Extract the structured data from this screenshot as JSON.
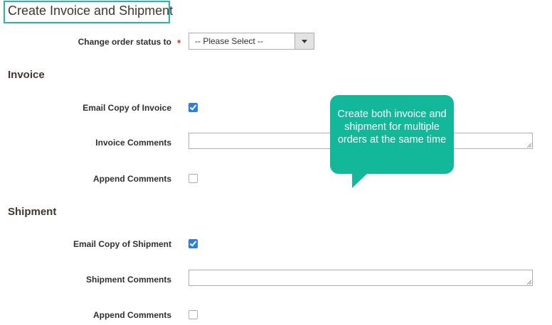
{
  "page": {
    "title": "Create Invoice and Shipment"
  },
  "order_status": {
    "label": "Change order status to",
    "required_mark": "*",
    "selected": "-- Please Select --"
  },
  "invoice": {
    "section_title": "Invoice",
    "email_copy_label": "Email Copy of Invoice",
    "email_copy_checked": true,
    "comments_label": "Invoice Comments",
    "comments_value": "",
    "append_label": "Append Comments",
    "append_checked": false
  },
  "shipment": {
    "section_title": "Shipment",
    "email_copy_label": "Email Copy of Shipment",
    "email_copy_checked": true,
    "comments_label": "Shipment Comments",
    "comments_value": "",
    "append_label": "Append Comments",
    "append_checked": false
  },
  "callout": {
    "text": "Create both invoice and shipment for multiple orders at the same time"
  },
  "colors": {
    "highlight_border": "#27b8a4",
    "callout_bg": "#13b89a",
    "checkbox_checked": "#2f7de1",
    "required": "#e22626"
  }
}
